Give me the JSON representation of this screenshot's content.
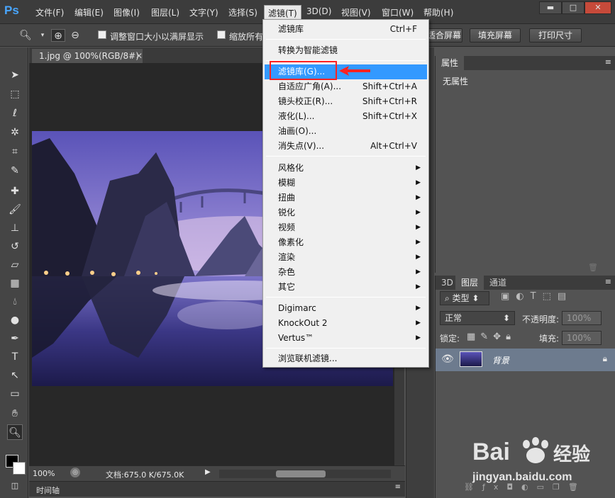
{
  "app": {
    "logo": "Ps"
  },
  "menubar": {
    "items": [
      "文件(F)",
      "编辑(E)",
      "图像(I)",
      "图层(L)",
      "文字(Y)",
      "选择(S)",
      "滤镜(T)",
      "3D(D)",
      "视图(V)",
      "窗口(W)",
      "帮助(H)"
    ],
    "active": "滤镜(T)"
  },
  "options": {
    "checkbox1_label": "调整窗口大小以满屏显示",
    "checkbox2_label": "缩放所有",
    "button_fit": "适合屏幕",
    "button_fill": "填充屏幕",
    "button_print": "打印尺寸"
  },
  "document": {
    "tab_title": "1.jpg @ 100%(RGB/8#)",
    "zoom": "100%",
    "doc_info": "文档:675.0 K/675.0K",
    "timeline_label": "时间轴"
  },
  "filter_menu": {
    "items": [
      {
        "label": "滤镜库",
        "shortcut": "Ctrl+F"
      },
      {
        "label": "转换为智能滤镜",
        "shortcut": ""
      },
      {
        "label": "滤镜库(G)...",
        "shortcut": "",
        "highlighted": true
      },
      {
        "label": "自适应广角(A)...",
        "shortcut": "Shift+Ctrl+A"
      },
      {
        "label": "镜头校正(R)...",
        "shortcut": "Shift+Ctrl+R"
      },
      {
        "label": "液化(L)...",
        "shortcut": "Shift+Ctrl+X"
      },
      {
        "label": "油画(O)...",
        "shortcut": ""
      },
      {
        "label": "消失点(V)...",
        "shortcut": "Alt+Ctrl+V"
      },
      {
        "label": "风格化",
        "submenu": true
      },
      {
        "label": "模糊",
        "submenu": true
      },
      {
        "label": "扭曲",
        "submenu": true
      },
      {
        "label": "锐化",
        "submenu": true
      },
      {
        "label": "视频",
        "submenu": true
      },
      {
        "label": "像素化",
        "submenu": true
      },
      {
        "label": "渲染",
        "submenu": true
      },
      {
        "label": "杂色",
        "submenu": true
      },
      {
        "label": "其它",
        "submenu": true
      },
      {
        "label": "Digimarc",
        "submenu": true
      },
      {
        "label": "KnockOut 2",
        "submenu": true
      },
      {
        "label": "Vertus™",
        "submenu": true
      },
      {
        "label": "浏览联机滤镜..."
      }
    ]
  },
  "properties_panel": {
    "tab": "属性",
    "content": "无属性"
  },
  "layers_panel": {
    "tabs": [
      "3D",
      "图层",
      "通道"
    ],
    "active_tab": "图层",
    "filter_kind": "类型",
    "blend_mode": "正常",
    "opacity_label": "不透明度:",
    "opacity_value": "100%",
    "lock_label": "锁定:",
    "fill_label": "填充:",
    "fill_value": "100%",
    "layers": [
      {
        "name": "背景",
        "visible": true,
        "locked": true
      }
    ]
  },
  "watermark": {
    "brand": "Baidu 经验",
    "url": "jingyan.baidu.com"
  },
  "colors": {
    "accent": "#3399ff",
    "annotation_red": "#ff2222",
    "ps_blue": "#49a6ff"
  }
}
